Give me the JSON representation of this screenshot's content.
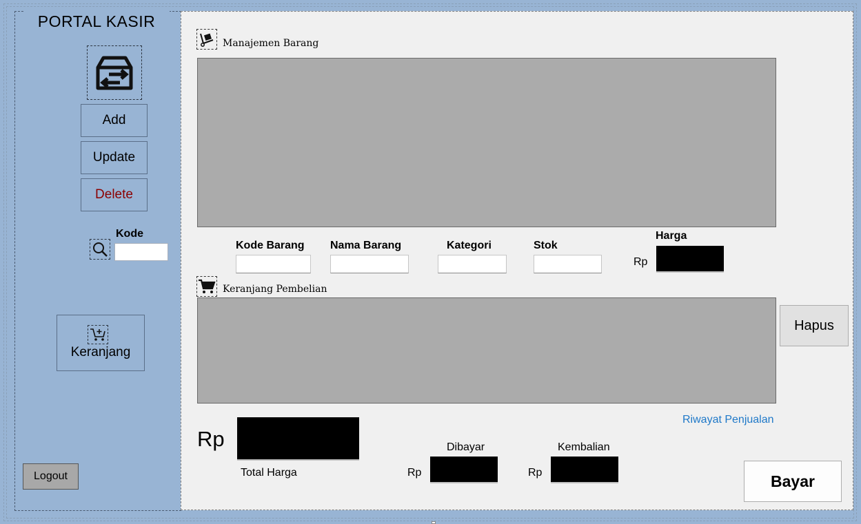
{
  "sidebar": {
    "app_title": "PORTAL KASIR",
    "logo_icon": "archive-transfer-icon",
    "buttons": {
      "add": "Add",
      "update": "Update",
      "delete": "Delete"
    },
    "search": {
      "label": "Kode",
      "icon": "search-icon",
      "value": ""
    },
    "cart_button": {
      "label": "Keranjang",
      "icon": "cart-add-icon"
    },
    "logout": "Logout"
  },
  "main": {
    "items_section": {
      "title": "Manajemen Barang",
      "icon": "hand-truck-icon"
    },
    "fields": {
      "kode_barang": "Kode Barang",
      "nama_barang": "Nama Barang",
      "kategori": "Kategori",
      "stok": "Stok",
      "harga": "Harga",
      "currency": "Rp"
    },
    "cart_section": {
      "title": "Keranjang Pembelian",
      "icon": "shopping-cart-icon"
    },
    "hapus": "Hapus",
    "riwayat_link": "Riwayat Penjualan",
    "totals": {
      "currency_large": "Rp",
      "total_label": "Total Harga",
      "dibayar_label": "Dibayar",
      "kembalian_label": "Kembalian",
      "currency": "Rp"
    },
    "bayar": "Bayar"
  },
  "colors": {
    "sidebar_bg": "#98b4d4",
    "main_bg": "#f0f0f0",
    "grid_bg": "#ababab",
    "delete_text": "#8b0000",
    "link": "#1e78c8"
  }
}
